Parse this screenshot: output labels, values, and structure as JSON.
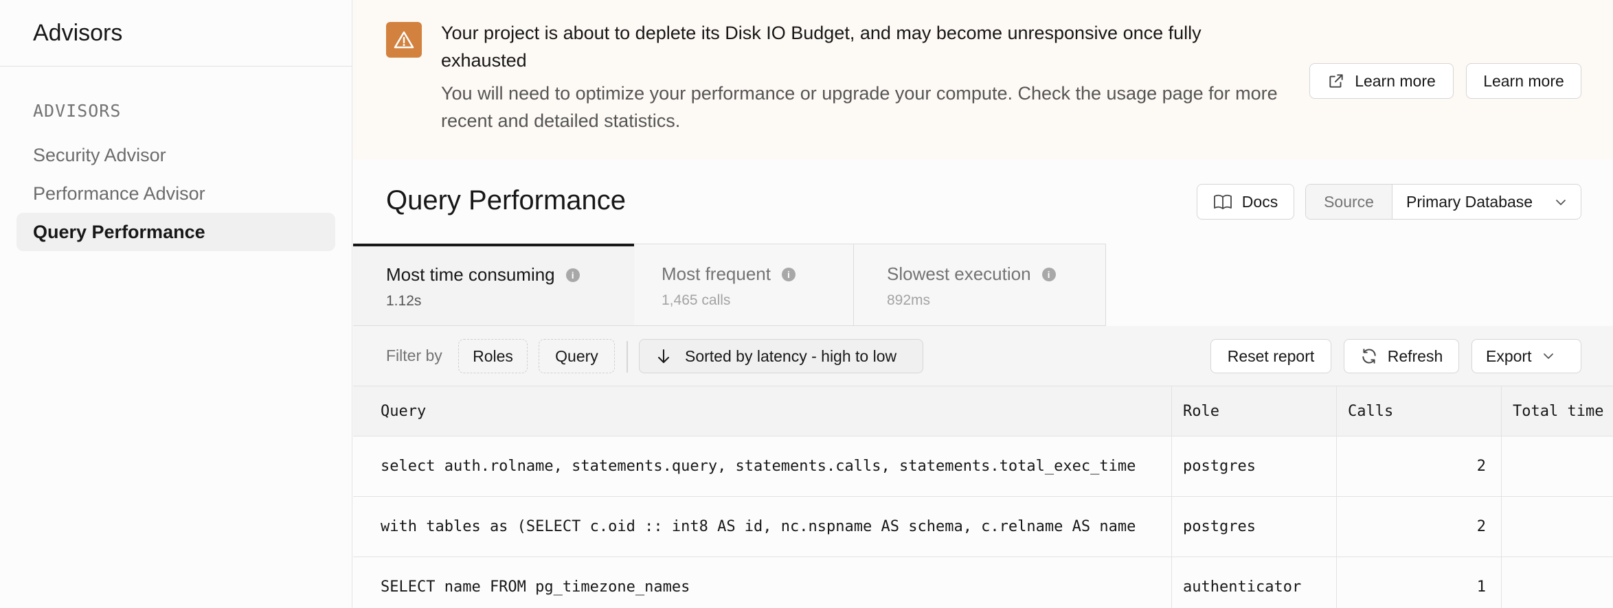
{
  "sidebar": {
    "title": "Advisors",
    "section_label": "ADVISORS",
    "items": [
      {
        "label": "Security Advisor",
        "active": false
      },
      {
        "label": "Performance Advisor",
        "active": false
      },
      {
        "label": "Query Performance",
        "active": true
      }
    ]
  },
  "banner": {
    "icon": "warning-triangle-icon",
    "title": "Your project is about to deplete its Disk IO Budget, and may become unresponsive once fully exhausted",
    "description": "You will need to optimize your performance or upgrade your compute. Check the usage page for more recent and detailed statistics.",
    "buttons": [
      "Learn more",
      "Learn more"
    ]
  },
  "header": {
    "title": "Query Performance",
    "docs_label": "Docs",
    "source_label": "Source",
    "source_value": "Primary Database"
  },
  "tabs": [
    {
      "label": "Most time consuming",
      "value": "1.12s",
      "active": true
    },
    {
      "label": "Most frequent",
      "value": "1,465 calls",
      "active": false
    },
    {
      "label": "Slowest execution",
      "value": "892ms",
      "active": false
    }
  ],
  "toolbar": {
    "filter_label": "Filter by",
    "chips": [
      "Roles",
      "Query"
    ],
    "sort_label": "Sorted by latency - high to low",
    "reset_label": "Reset report",
    "refresh_label": "Refresh",
    "export_label": "Export"
  },
  "table": {
    "columns": [
      "Query",
      "Role",
      "Calls",
      "Total time"
    ],
    "rows": [
      {
        "query": "select auth.rolname, statements.query, statements.calls, statements.total_exec_time",
        "role": "postgres",
        "calls": "2"
      },
      {
        "query": "with tables as (SELECT c.oid :: int8 AS id, nc.nspname AS schema, c.relname AS name",
        "role": "postgres",
        "calls": "2"
      },
      {
        "query": "SELECT name FROM pg_timezone_names",
        "role": "authenticator",
        "calls": "1"
      }
    ]
  },
  "colors": {
    "warning_accent": "#d2813e",
    "banner_bg": "#fdf9f4",
    "active_tab_border": "#171717"
  }
}
